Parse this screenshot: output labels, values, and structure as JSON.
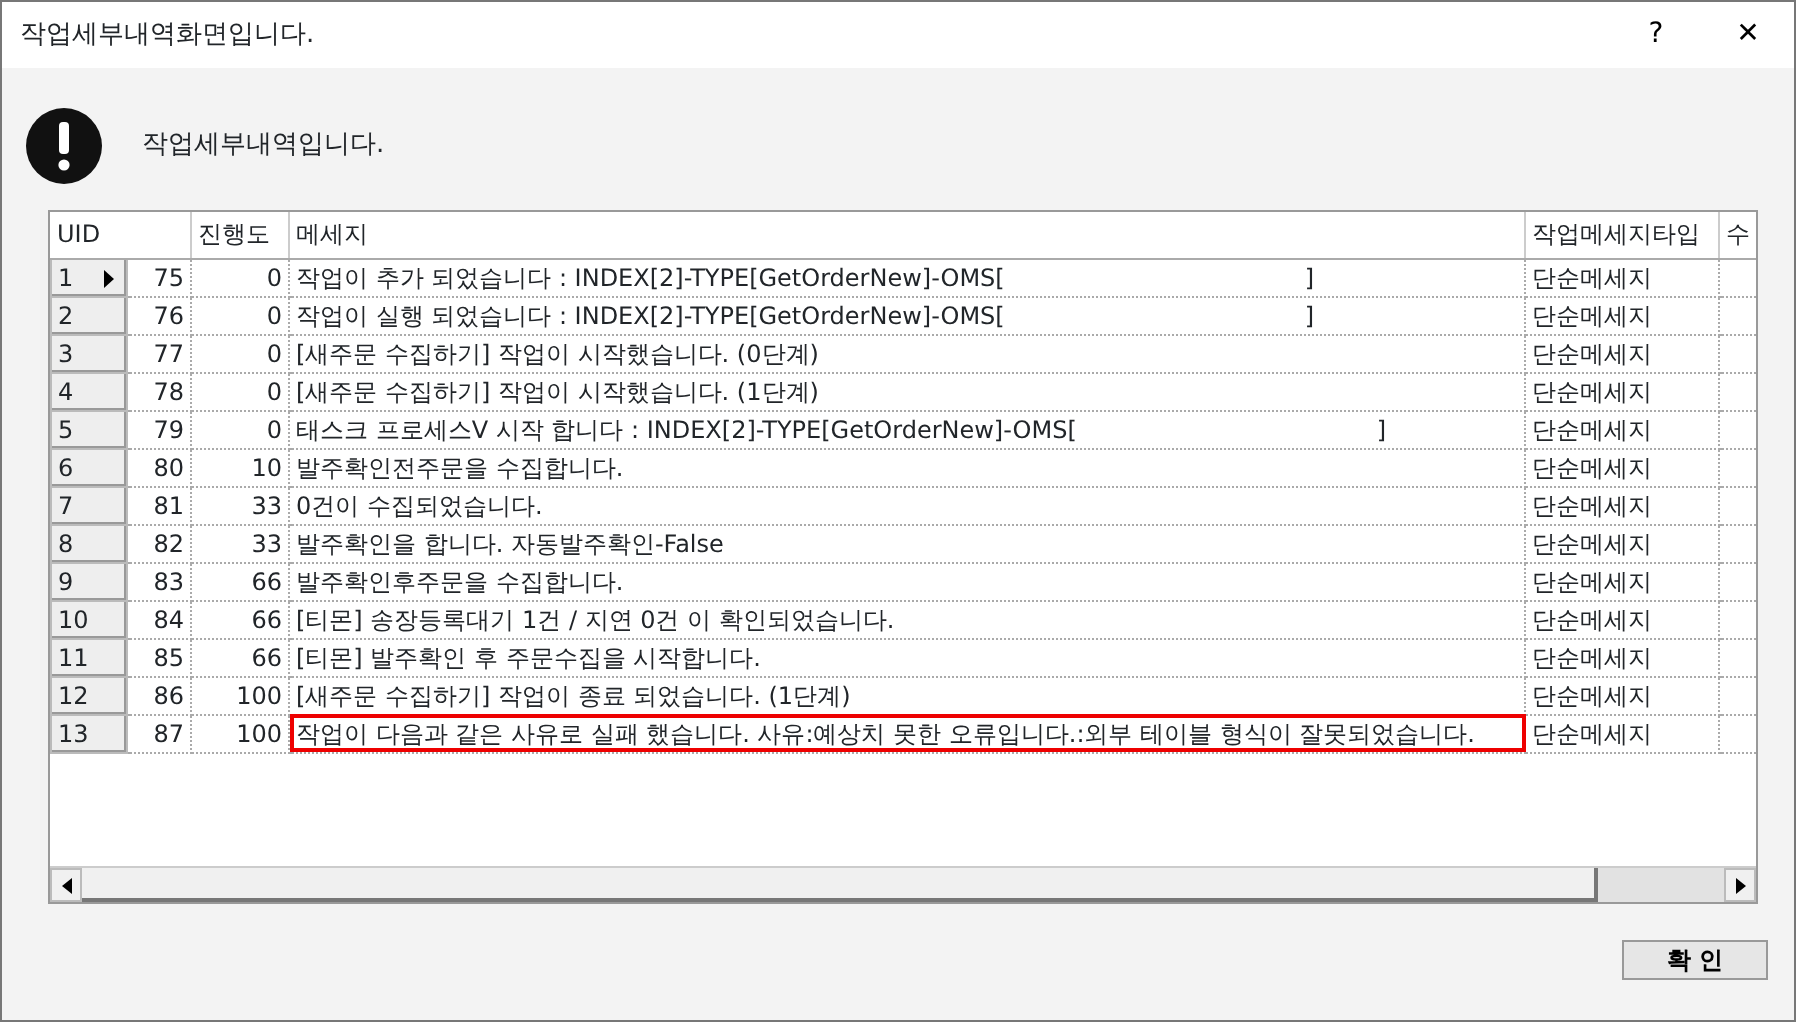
{
  "window": {
    "title": "작업세부내역화면입니다.",
    "help": "?",
    "close": "✕"
  },
  "header": {
    "message": "작업세부내역입니다."
  },
  "table": {
    "columns": [
      "UID",
      "진행도",
      "메세지",
      "작업메세지타입",
      "수"
    ],
    "rows": [
      {
        "row_number": "1",
        "current": true,
        "flagged": false,
        "uid": "75",
        "progress": "0",
        "message": "작업이 추가 되었습니다 : INDEX[2]-TYPE[GetOrderNew]-OMS[",
        "message_end": "]",
        "type": "단순메세지"
      },
      {
        "row_number": "2",
        "current": false,
        "flagged": false,
        "uid": "76",
        "progress": "0",
        "message": "작업이 실행 되었습니다 : INDEX[2]-TYPE[GetOrderNew]-OMS[",
        "message_end": "]",
        "type": "단순메세지"
      },
      {
        "row_number": "3",
        "current": false,
        "flagged": false,
        "uid": "77",
        "progress": "0",
        "message": "[새주문 수집하기] 작업이 시작했습니다. (0단계)",
        "type": "단순메세지"
      },
      {
        "row_number": "4",
        "current": false,
        "flagged": false,
        "uid": "78",
        "progress": "0",
        "message": "[새주문 수집하기] 작업이 시작했습니다. (1단계)",
        "type": "단순메세지"
      },
      {
        "row_number": "5",
        "current": false,
        "flagged": false,
        "uid": "79",
        "progress": "0",
        "message": "태스크 프로세스V 시작 합니다 : INDEX[2]-TYPE[GetOrderNew]-OMS[",
        "message_end": "]",
        "type": "단순메세지"
      },
      {
        "row_number": "6",
        "current": false,
        "flagged": false,
        "uid": "80",
        "progress": "10",
        "message": "발주확인전주문을 수집합니다.",
        "type": "단순메세지"
      },
      {
        "row_number": "7",
        "current": false,
        "flagged": false,
        "uid": "81",
        "progress": "33",
        "message": "0건이 수집되었습니다.",
        "type": "단순메세지"
      },
      {
        "row_number": "8",
        "current": false,
        "flagged": false,
        "uid": "82",
        "progress": "33",
        "message": "발주확인을  합니다.  자동발주확인-False",
        "type": "단순메세지"
      },
      {
        "row_number": "9",
        "current": false,
        "flagged": false,
        "uid": "83",
        "progress": "66",
        "message": "발주확인후주문을 수집합니다.",
        "type": "단순메세지"
      },
      {
        "row_number": "10",
        "current": false,
        "flagged": false,
        "uid": "84",
        "progress": "66",
        "message": "[티몬] 송장등록대기 1건 / 지연 0건 이 확인되었습니다.",
        "type": "단순메세지"
      },
      {
        "row_number": "11",
        "current": false,
        "flagged": false,
        "uid": "85",
        "progress": "66",
        "message": "[티몬] 발주확인 후 주문수집을 시작합니다.",
        "type": "단순메세지"
      },
      {
        "row_number": "12",
        "current": false,
        "flagged": false,
        "uid": "86",
        "progress": "100",
        "message": "[새주문 수집하기] 작업이 종료 되었습니다. (1단계)",
        "type": "단순메세지"
      },
      {
        "row_number": "13",
        "current": false,
        "flagged": true,
        "uid": "87",
        "progress": "100",
        "message": "작업이 다음과 같은 사유로 실패 했습니다. 사유:예상치 못한 오류입니다.:외부 테이블 형식이 잘못되었습니다.",
        "type": "단순메세지"
      }
    ]
  },
  "buttons": {
    "ok": "확 인"
  }
}
